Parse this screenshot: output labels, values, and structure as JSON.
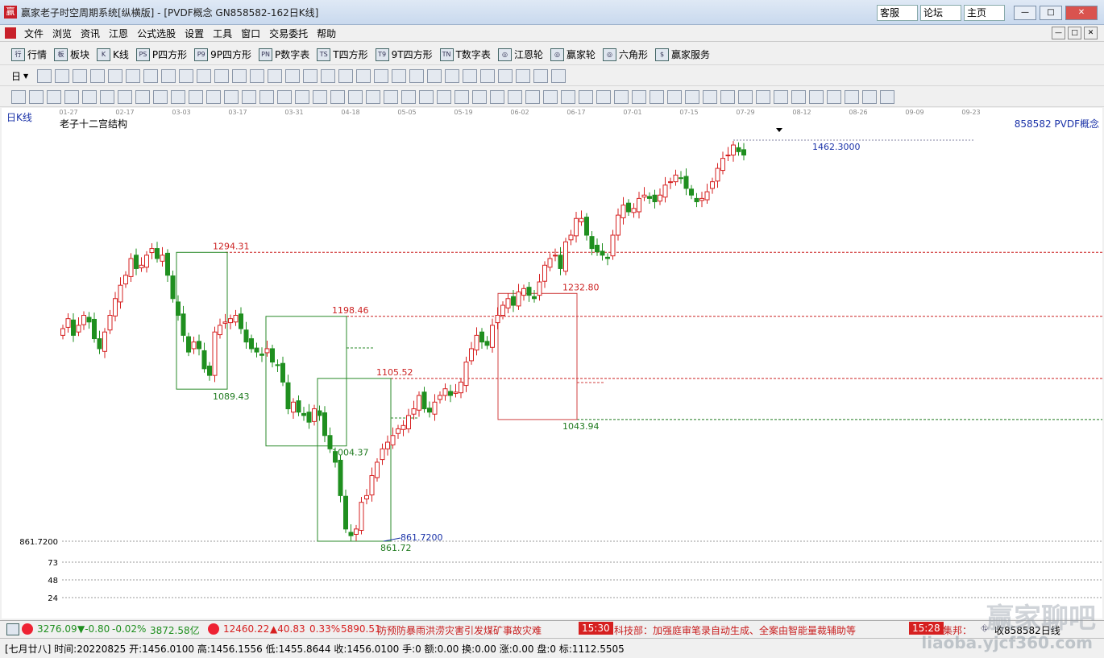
{
  "window": {
    "title": "赢家老子时空周期系统[纵横版] - [PVDF概念  GN858582-162日K线]",
    "logo_text": "赢",
    "links": [
      "客服",
      "论坛",
      "主页"
    ],
    "controls": [
      "—",
      "□",
      "✕"
    ]
  },
  "menu": [
    "文件",
    "浏览",
    "资讯",
    "江恩",
    "公式选股",
    "设置",
    "工具",
    "窗口",
    "交易委托",
    "帮助"
  ],
  "toolbar1": [
    {
      "icon": "行",
      "label": "行情"
    },
    {
      "icon": "板",
      "label": "板块"
    },
    {
      "icon": "K",
      "label": "K线"
    },
    {
      "icon": "PS",
      "label": "P四方形"
    },
    {
      "icon": "P9",
      "label": "9P四方形"
    },
    {
      "icon": "PN",
      "label": "P数字表"
    },
    {
      "icon": "TS",
      "label": "T四方形"
    },
    {
      "icon": "T9",
      "label": "9T四方形"
    },
    {
      "icon": "TN",
      "label": "T数字表"
    },
    {
      "icon": "◎",
      "label": "江恩轮"
    },
    {
      "icon": "◎",
      "label": "赢家轮"
    },
    {
      "icon": "◎",
      "label": "六角形"
    },
    {
      "icon": "$",
      "label": "赢家服务"
    }
  ],
  "toolbar2_first_label": "日",
  "chart": {
    "period_label": "日K线",
    "indicator_title": "老子十二宫结构",
    "security_label": "858582 PVDF概念",
    "date_ticks": [
      "01-27",
      "02-17",
      "03-03",
      "03-17",
      "03-31",
      "04-18",
      "05-05",
      "05-19",
      "06-02",
      "06-17",
      "07-01",
      "07-15",
      "07-29",
      "08-12",
      "08-26",
      "09-09",
      "09-23"
    ],
    "y_axis_labels": [
      "861.7200",
      "73",
      "48",
      "24"
    ],
    "levels": [
      {
        "value": "1294.31",
        "color": "#cc2222"
      },
      {
        "value": "1198.46",
        "color": "#cc2222"
      },
      {
        "value": "1105.52",
        "color": "#cc2222"
      },
      {
        "value": "1043.94",
        "color": "#1f7a1f"
      }
    ],
    "box_labels": {
      "high_1294": "1294.31",
      "low_1089": "1089.43",
      "high_1198": "1198.46",
      "low_1004": "1004.37",
      "high_1105": "1105.52",
      "low_861": "861.72",
      "high_1232": "1232.80",
      "low_1043": "1043.94"
    },
    "annotations": {
      "max_price": "1462.3000",
      "min_price": "861.7200"
    }
  },
  "chart_data": {
    "type": "candlestick",
    "title": "老子十二宫结构",
    "series_name": "858582 PVDF概念",
    "y_range": [
      861.72,
      1462.3
    ],
    "x_ticks": [
      "01-27",
      "02-17",
      "03-03",
      "03-17",
      "03-31",
      "04-18",
      "05-05",
      "05-19",
      "06-02",
      "06-17",
      "07-01",
      "07-15",
      "07-29",
      "08-12",
      "08-26",
      "09-09",
      "09-23"
    ],
    "price_levels": [
      1294.31,
      1198.46,
      1105.52,
      1043.94
    ],
    "boxes": [
      {
        "high": 1294.31,
        "low": 1089.43,
        "color": "green"
      },
      {
        "high": 1198.46,
        "low": 1004.37,
        "color": "green"
      },
      {
        "high": 1105.52,
        "low": 861.72,
        "color": "green"
      },
      {
        "high": 1232.8,
        "low": 1043.94,
        "color": "red"
      }
    ],
    "closes": [
      1180,
      1195,
      1170,
      1185,
      1200,
      1190,
      1165,
      1150,
      1175,
      1200,
      1225,
      1245,
      1260,
      1285,
      1270,
      1275,
      1290,
      1300,
      1285,
      1290,
      1260,
      1225,
      1200,
      1170,
      1145,
      1160,
      1150,
      1120,
      1110,
      1175,
      1185,
      1190,
      1195,
      1200,
      1180,
      1160,
      1150,
      1145,
      1140,
      1150,
      1130,
      1125,
      1100,
      1060,
      1070,
      1055,
      1050,
      1040,
      1060,
      1050,
      1020,
      1000,
      980,
      930,
      880,
      870,
      880,
      920,
      930,
      960,
      980,
      1000,
      1010,
      1020,
      1030,
      1035,
      1050,
      1060,
      1080,
      1060,
      1055,
      1070,
      1080,
      1090,
      1080,
      1085,
      1100,
      1130,
      1150,
      1170,
      1160,
      1155,
      1185,
      1200,
      1215,
      1225,
      1215,
      1235,
      1240,
      1230,
      1225,
      1250,
      1275,
      1285,
      1290,
      1270,
      1310,
      1320,
      1345,
      1345,
      1320,
      1300,
      1295,
      1290,
      1285,
      1320,
      1350,
      1365,
      1355,
      1360,
      1375,
      1380,
      1375,
      1370,
      1380,
      1395,
      1400,
      1410,
      1405,
      1390,
      1380,
      1370,
      1375,
      1385,
      1400,
      1420,
      1435,
      1440,
      1455,
      1445,
      1440
    ]
  },
  "status": {
    "idx1_value": "3276.09",
    "idx1_change": "▼-0.80",
    "idx1_pct": "-0.02%",
    "idx1_amount": "3872.58亿",
    "idx2_value": "12460.22",
    "idx2_change": "▲40.83",
    "idx2_pct": "0.33%",
    "idx2_amount": "5890.51",
    "news1": "防预防暴雨洪涝灾害引发煤矿事故灾难",
    "time1": "15:30",
    "news2": "科技部：加强庭审笔录自动生成、全案由智能量裁辅助等",
    "time2": "15:28",
    "news3": "集邦：",
    "right_text": "收858582日线"
  },
  "info": {
    "text": "[七月廿八] 时间:20220825 开:1456.0100 高:1456.1556 低:1455.8644 收:1456.0100 手:0 额:0.00 换:0.00 涨:0.00 盘:0 标:1112.5505"
  },
  "watermark": {
    "line1": "赢家聊吧",
    "line2": "liaoba.yjcf360.com"
  },
  "colors": {
    "up": "#d62020",
    "down": "#1f8f1f",
    "box_green": "#2a8a2a",
    "box_red": "#d04040",
    "level_red": "#cc2222",
    "level_green": "#1f7a1f",
    "max_label": "#1a32a8"
  }
}
